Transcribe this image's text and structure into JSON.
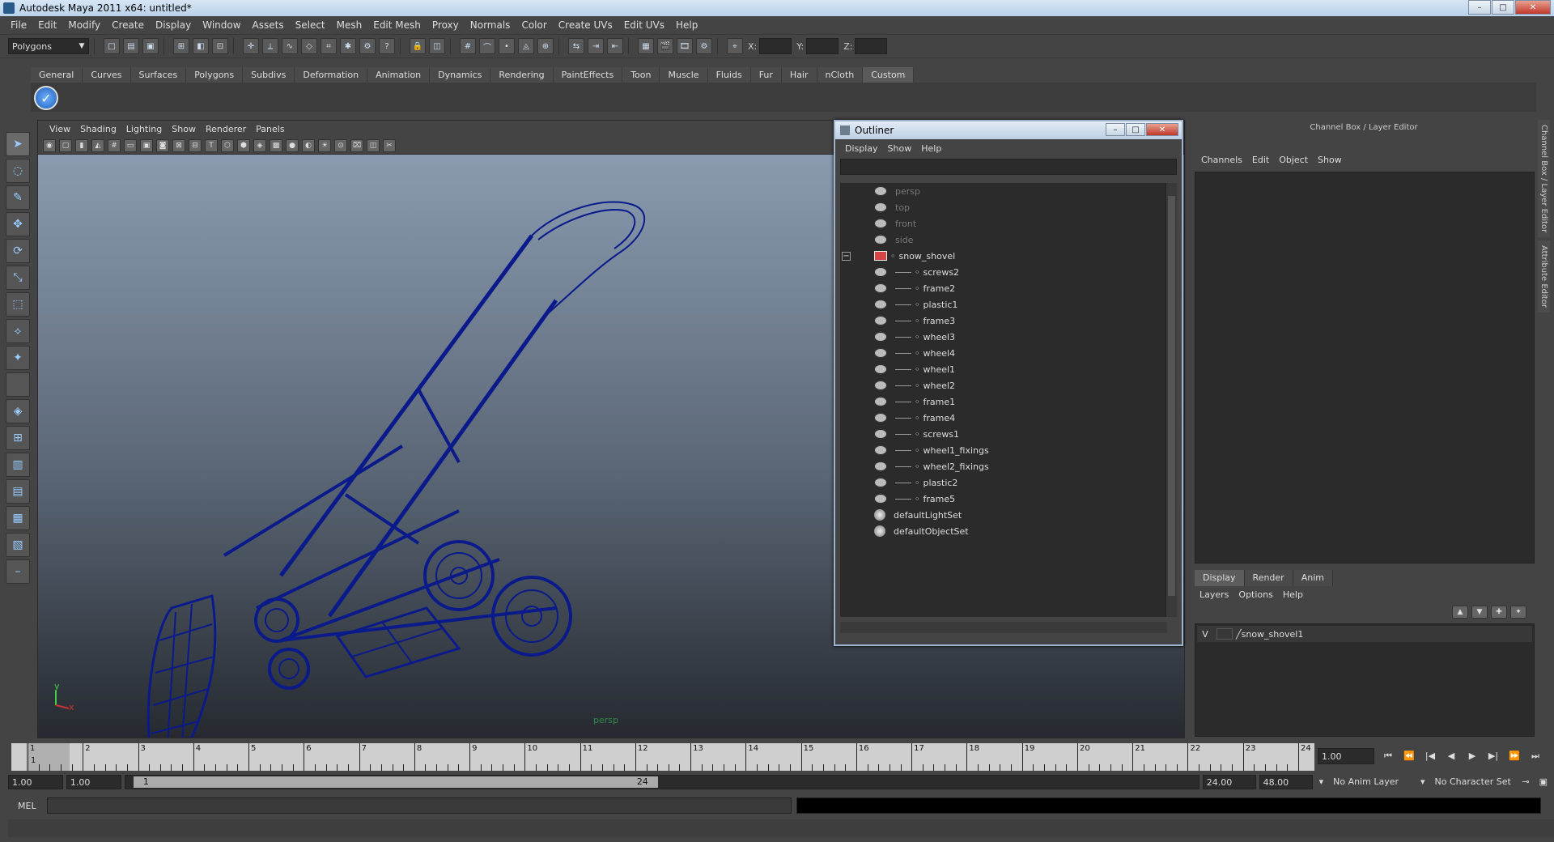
{
  "window": {
    "title": "Autodesk Maya 2011 x64: untitled*",
    "min": "–",
    "max": "□",
    "close": "✕"
  },
  "menubar": [
    "File",
    "Edit",
    "Modify",
    "Create",
    "Display",
    "Window",
    "Assets",
    "Select",
    "Mesh",
    "Edit Mesh",
    "Proxy",
    "Normals",
    "Color",
    "Create UVs",
    "Edit UVs",
    "Help"
  ],
  "statusline": {
    "mode": "Polygons",
    "x_label": "X:",
    "y_label": "Y:",
    "z_label": "Z:"
  },
  "shelf": {
    "tabs": [
      "General",
      "Curves",
      "Surfaces",
      "Polygons",
      "Subdivs",
      "Deformation",
      "Animation",
      "Dynamics",
      "Rendering",
      "PaintEffects",
      "Toon",
      "Muscle",
      "Fluids",
      "Fur",
      "Hair",
      "nCloth",
      "Custom"
    ],
    "active_tab": "Custom"
  },
  "viewport": {
    "menu": [
      "View",
      "Shading",
      "Lighting",
      "Show",
      "Renderer",
      "Panels"
    ],
    "camera": "persp",
    "axis_y": "y",
    "axis_x": "x",
    "wire_color": "#0a1a8a"
  },
  "outliner": {
    "title": "Outliner",
    "menu": [
      "Display",
      "Show",
      "Help"
    ],
    "cameras": [
      "persp",
      "top",
      "front",
      "side"
    ],
    "group": "snow_shovel",
    "children": [
      "screws2",
      "frame2",
      "plastic1",
      "frame3",
      "wheel3",
      "wheel4",
      "wheel1",
      "wheel2",
      "frame1",
      "frame4",
      "screws1",
      "wheel1_fixings",
      "wheel2_fixings",
      "plastic2",
      "frame5"
    ],
    "sets": [
      "defaultLightSet",
      "defaultObjectSet"
    ]
  },
  "channelbox": {
    "title": "Channel Box / Layer Editor",
    "menu": [
      "Channels",
      "Edit",
      "Object",
      "Show"
    ],
    "layer_tabs": [
      "Display",
      "Render",
      "Anim"
    ],
    "active_layer_tab": "Display",
    "layer_menu": [
      "Layers",
      "Options",
      "Help"
    ],
    "layer": {
      "visible": "V",
      "name": "snow_shovel1"
    },
    "side_tabs": [
      "Channel Box / Layer Editor",
      "Attribute Editor"
    ]
  },
  "timeslider": {
    "ticks": [
      "1",
      "2",
      "3",
      "4",
      "5",
      "6",
      "7",
      "8",
      "9",
      "10",
      "11",
      "12",
      "13",
      "14",
      "15",
      "16",
      "17",
      "18",
      "19",
      "20",
      "21",
      "22",
      "23",
      "24"
    ],
    "current": "1",
    "current_field": "1.00",
    "buttons": [
      "⏮",
      "⏪",
      "|◀",
      "◀",
      "▶",
      "▶|",
      "⏩",
      "⏭"
    ]
  },
  "range": {
    "start": "1.00",
    "anim_start": "1.00",
    "range_start": "1",
    "range_end": "24",
    "end": "24.00",
    "anim_end": "48.00",
    "anim_layer": "No Anim Layer",
    "char_set": "No Character Set"
  },
  "cmdline": {
    "label": "MEL"
  }
}
